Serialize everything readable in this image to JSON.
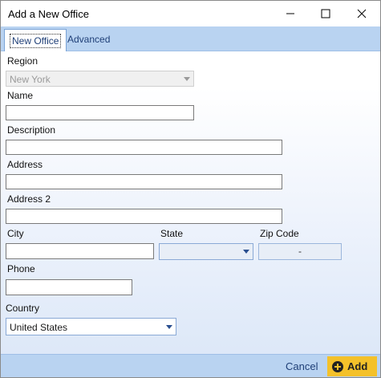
{
  "window": {
    "title": "Add a New Office"
  },
  "tabs": [
    {
      "label": "New Office",
      "active": true
    },
    {
      "label": "Advanced",
      "active": false
    }
  ],
  "form": {
    "region": {
      "label": "Region",
      "value": "New York",
      "disabled": true
    },
    "name": {
      "label": "Name",
      "value": ""
    },
    "description": {
      "label": "Description",
      "value": ""
    },
    "address": {
      "label": "Address",
      "value": ""
    },
    "address2": {
      "label": "Address 2",
      "value": ""
    },
    "city": {
      "label": "City",
      "value": ""
    },
    "state": {
      "label": "State",
      "value": ""
    },
    "zip": {
      "label": "Zip Code",
      "value": "-"
    },
    "phone": {
      "label": "Phone",
      "value": ""
    },
    "country": {
      "label": "Country",
      "value": "United States"
    }
  },
  "footer": {
    "cancel_label": "Cancel",
    "add_label": "Add"
  },
  "colors": {
    "accent": "#f4c12a",
    "tabstrip": "#b9d3f1",
    "link": "#1f3f77"
  }
}
